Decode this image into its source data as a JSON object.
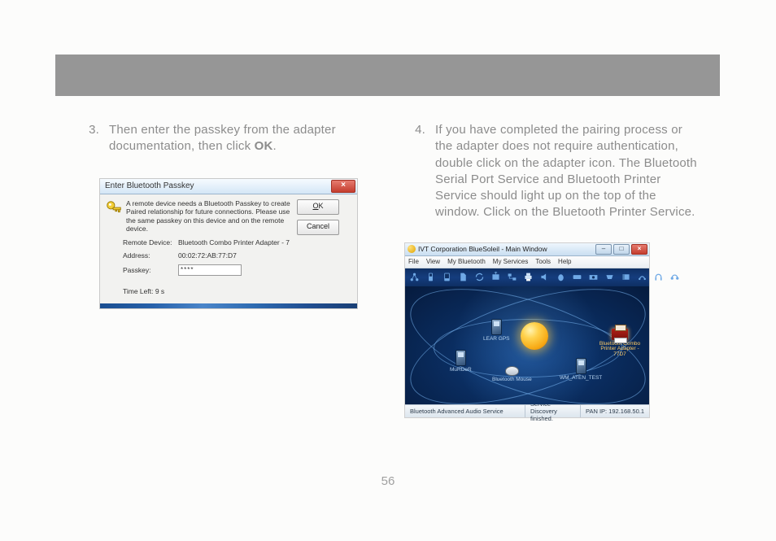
{
  "page_number": "56",
  "left": {
    "step_number": "3.",
    "step_text_1": "Then enter the passkey from the adapter documentation, then click ",
    "step_text_bold": "OK",
    "step_text_2": "."
  },
  "right": {
    "step_number": "4.",
    "step_text": "If you have completed the pairing process or the adapter does not require authentication, double click on the adapter icon. The Bluetooth Serial Port Service and Bluetooth Printer Service should light up on the top of the window. Click on the Bluetooth Printer Service."
  },
  "passkey_dialog": {
    "title": "Enter Bluetooth Passkey",
    "close_glyph": "×",
    "message": "A remote device needs a Bluetooth Passkey to create Paired relationship for future connections. Please use the same passkey on this device and on the remote device.",
    "remote_device_label": "Remote Device:",
    "remote_device_value": "Bluetooth Combo Printer Adapter - 7",
    "address_label": "Address:",
    "address_value": "00:02:72:AB:77:D7",
    "passkey_label": "Passkey:",
    "passkey_value": "****",
    "time_left": "Time Left: 9 s",
    "ok": "OK",
    "cancel": "Cancel"
  },
  "bluesoleil": {
    "title": "IVT Corporation BlueSoleil - Main Window",
    "menu": [
      "File",
      "View",
      "My Bluetooth",
      "My Services",
      "Tools",
      "Help"
    ],
    "toolbar_icons": [
      "network-icon",
      "phone-icon",
      "pda-icon",
      "file-icon",
      "sync-icon",
      "push-icon",
      "lan-icon",
      "printer-icon",
      "audio-icon",
      "mouse-icon",
      "keyboard-icon",
      "camera-icon",
      "serial-icon",
      "fax-icon",
      "dialup-icon",
      "headset-icon",
      "a2dp-icon"
    ],
    "devices": {
      "gps": {
        "label": "LEAR GPS"
      },
      "murder": {
        "label": "MuRDeR"
      },
      "mouse": {
        "label": "Bluetooth Mouse"
      },
      "wm": {
        "label": "WM_ATEN_TEST"
      },
      "printer": {
        "label": "Bluetooth Combo Printer Adapter - 77D7"
      }
    },
    "status": {
      "left": "Bluetooth Advanced Audio Service",
      "mid": "Service Discovery finished.",
      "right": "PAN IP: 192.168.50.1"
    },
    "win_buttons": {
      "min": "–",
      "max": "□",
      "close": "×"
    }
  }
}
